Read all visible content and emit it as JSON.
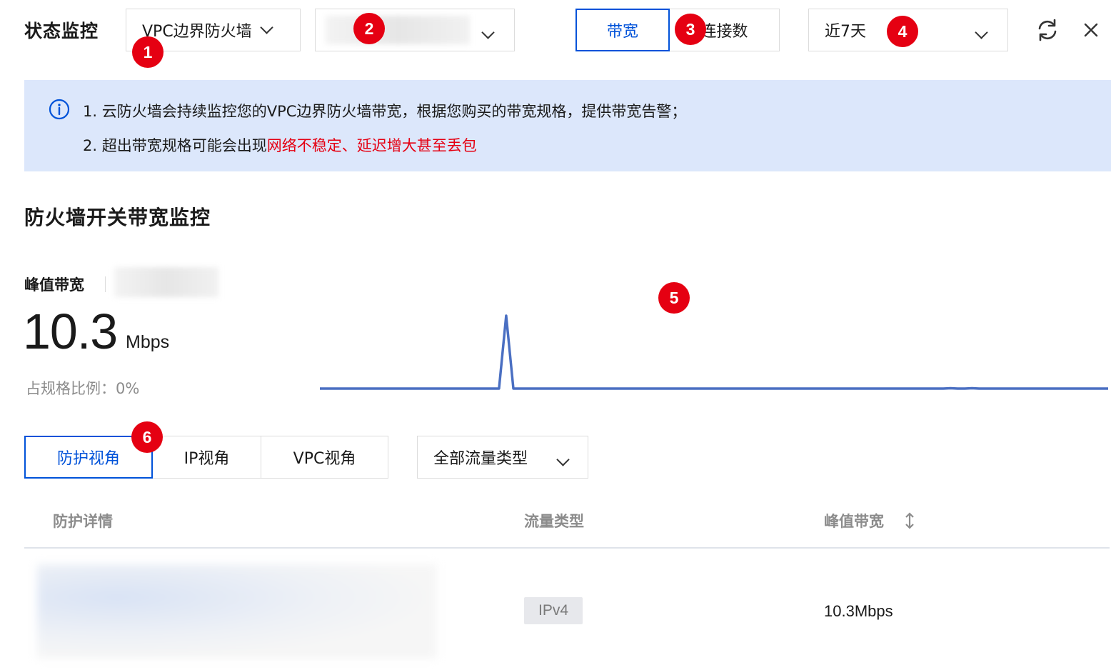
{
  "header": {
    "title": "状态监控",
    "firewall_select": "VPC边界防火墙",
    "metric_tabs": [
      "带宽",
      "连接数"
    ],
    "time_select": "近7天"
  },
  "notice": {
    "line1": "1. 云防火墙会持续监控您的VPC边界防火墙带宽，根据您购买的带宽规格，提供带宽告警；",
    "line2_prefix": "2. 超出带宽规格可能会出现",
    "line2_highlight": "网络不稳定、延迟增大甚至丢包"
  },
  "section": {
    "title": "防火墙开关带宽监控",
    "peak_label": "峰值带宽",
    "peak_value": "10.3",
    "peak_unit": "Mbps",
    "ratio_text": "占规格比例：0%"
  },
  "chart_data": {
    "type": "line",
    "x": [
      0,
      1,
      2,
      3,
      4,
      5,
      6,
      7,
      8,
      9,
      10,
      11,
      12,
      13,
      14,
      15,
      16,
      17,
      18,
      19,
      20,
      21,
      22,
      23,
      24,
      25,
      26,
      27,
      28,
      29,
      30,
      31,
      32,
      33,
      34,
      35,
      36,
      37,
      38,
      39,
      40,
      41,
      42,
      43,
      44,
      45,
      46,
      47,
      48,
      49,
      50,
      51,
      52,
      53,
      54,
      55,
      56,
      57,
      58,
      59,
      60,
      61,
      62,
      63,
      64,
      65,
      66,
      67,
      68,
      69,
      70,
      71,
      72,
      73,
      74,
      75,
      76,
      77,
      78,
      79,
      80,
      81,
      82,
      83,
      84,
      85,
      86,
      87,
      88,
      89,
      90,
      91,
      92,
      93,
      94,
      95,
      96,
      97,
      98,
      99,
      100,
      101,
      102,
      103,
      104,
      105,
      106,
      107,
      108,
      109,
      110
    ],
    "values": [
      0,
      0,
      0,
      0,
      0,
      0,
      0,
      0,
      0,
      0,
      0,
      0,
      0,
      0,
      0,
      0,
      0,
      0,
      0,
      0,
      0,
      0,
      0,
      0,
      0,
      0,
      10.3,
      0,
      0,
      0,
      0,
      0,
      0,
      0,
      0,
      0,
      0,
      0,
      0,
      0,
      0,
      0,
      0,
      0,
      0,
      0,
      0,
      0,
      0,
      0,
      0,
      0,
      0,
      0,
      0,
      0,
      0,
      0,
      0,
      0,
      0,
      0,
      0,
      0,
      0,
      0,
      0,
      0,
      0,
      0,
      0,
      0,
      0,
      0,
      0,
      0,
      0,
      0,
      0,
      0,
      0,
      0,
      0,
      0,
      0,
      0,
      0,
      0,
      0.05,
      0,
      0,
      0.05,
      0,
      0,
      0,
      0,
      0,
      0,
      0,
      0,
      0,
      0,
      0,
      0,
      0,
      0,
      0,
      0,
      0,
      0,
      0
    ],
    "ylim": [
      0,
      10.3
    ],
    "color": "#4a6fc2"
  },
  "view_tabs": [
    "防护视角",
    "IP视角",
    "VPC视角"
  ],
  "traffic_select": "全部流量类型",
  "table": {
    "headers": [
      "防护详情",
      "流量类型",
      "峰值带宽"
    ],
    "rows": [
      {
        "type": "IPv4",
        "peak": "10.3Mbps"
      }
    ]
  },
  "badges": [
    "1",
    "2",
    "3",
    "4",
    "5",
    "6"
  ],
  "colors": {
    "accent": "#0052d9",
    "badge": "#e50012",
    "notice_bg": "#dce7fb",
    "warning_text": "#e50012"
  },
  "icons": [
    "chevron-down-icon",
    "refresh-icon",
    "close-icon",
    "info-icon",
    "sort-icon"
  ]
}
